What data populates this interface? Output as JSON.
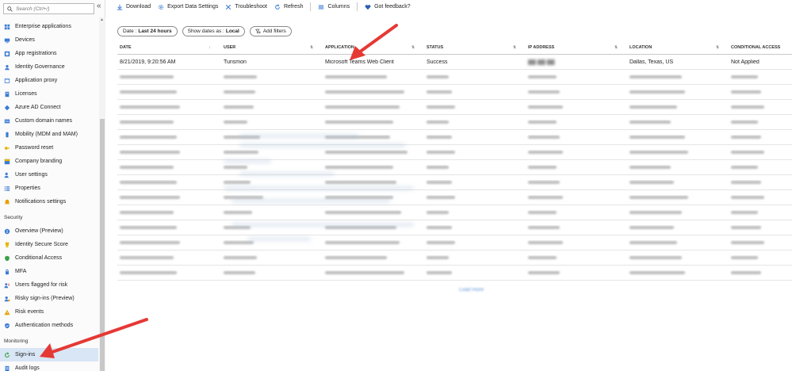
{
  "sidebar": {
    "search_placeholder": "Search (Ctrl+/)",
    "collapse_glyph": "«",
    "items_top": [
      {
        "label": "Enterprise applications",
        "icon": "grid-apps-icon",
        "color": "#3a7bd5"
      },
      {
        "label": "Devices",
        "icon": "devices-icon",
        "color": "#3a7bd5"
      },
      {
        "label": "App registrations",
        "icon": "app-registrations-icon",
        "color": "#3a7bd5"
      },
      {
        "label": "Identity Governance",
        "icon": "identity-governance-icon",
        "color": "#3a7bd5"
      },
      {
        "label": "Application proxy",
        "icon": "application-proxy-icon",
        "color": "#3a7bd5"
      },
      {
        "label": "Licenses",
        "icon": "licenses-icon",
        "color": "#3a7bd5"
      },
      {
        "label": "Azure AD Connect",
        "icon": "azure-ad-connect-icon",
        "color": "#3a7bd5"
      },
      {
        "label": "Custom domain names",
        "icon": "custom-domain-icon",
        "color": "#3a7bd5"
      },
      {
        "label": "Mobility (MDM and MAM)",
        "icon": "mobility-icon",
        "color": "#3a7bd5"
      },
      {
        "label": "Password reset",
        "icon": "key-icon",
        "color": "#e8b400"
      },
      {
        "label": "Company branding",
        "icon": "company-branding-icon",
        "color": "#3a7bd5"
      },
      {
        "label": "User settings",
        "icon": "user-settings-icon",
        "color": "#3a7bd5"
      },
      {
        "label": "Properties",
        "icon": "properties-icon",
        "color": "#3a7bd5"
      },
      {
        "label": "Notifications settings",
        "icon": "bell-icon",
        "color": "#e8a000"
      }
    ],
    "security_heading": "Security",
    "items_security": [
      {
        "label": "Overview (Preview)",
        "icon": "info-icon",
        "color": "#3a7bd5"
      },
      {
        "label": "Identity Secure Score",
        "icon": "trophy-icon",
        "color": "#e8b400"
      },
      {
        "label": "Conditional Access",
        "icon": "shield-icon",
        "color": "#3aa047"
      },
      {
        "label": "MFA",
        "icon": "mfa-icon",
        "color": "#3a7bd5"
      },
      {
        "label": "Users flagged for risk",
        "icon": "users-flagged-icon",
        "color": "#3a7bd5"
      },
      {
        "label": "Risky sign-ins (Preview)",
        "icon": "risky-signins-icon",
        "color": "#3a7bd5"
      },
      {
        "label": "Risk events",
        "icon": "warning-icon",
        "color": "#e8a000"
      },
      {
        "label": "Authentication methods",
        "icon": "auth-shield-icon",
        "color": "#3a7bd5"
      }
    ],
    "monitoring_heading": "Monitoring",
    "items_monitoring": [
      {
        "label": "Sign-ins",
        "icon": "signins-icon",
        "color": "#3aa047"
      },
      {
        "label": "Audit logs",
        "icon": "audit-logs-icon",
        "color": "#3a7bd5"
      }
    ]
  },
  "toolbar": {
    "download": "Download",
    "export": "Export Data Settings",
    "troubleshoot": "Troubleshoot",
    "refresh": "Refresh",
    "columns": "Columns",
    "feedback": "Got feedback?",
    "accent": "#3a7bd5"
  },
  "filters": {
    "date_label": "Date :",
    "date_value": "Last 24 hours",
    "show_dates_label": "Show dates as :",
    "show_dates_value": "Local",
    "add_filters": "Add filters"
  },
  "table": {
    "headers": [
      "DATE",
      "USER",
      "APPLICATION",
      "STATUS",
      "IP ADDRESS",
      "LOCATION",
      "CONDITIONAL ACCESS"
    ],
    "rows": [
      [
        "8/21/2019, 9:20:56 AM",
        "Turismon",
        "Microsoft Teams Web Client",
        "Success",
        "██ ██ ██",
        "Dallas, Texas, US",
        "Not Applied"
      ]
    ],
    "blurred_row_count": 14
  },
  "load_more": "Load more"
}
